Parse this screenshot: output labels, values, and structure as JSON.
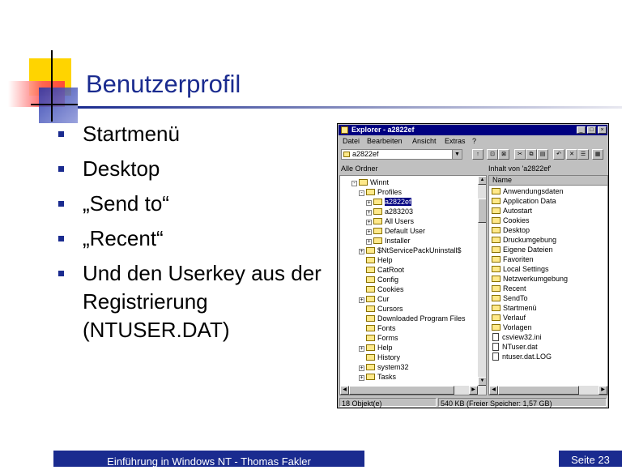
{
  "slide": {
    "title": "Benutzerprofil",
    "bullets": [
      "Startmenü",
      "Desktop",
      "„Send to“",
      "„Recent“",
      "Und den Userkey aus der Registrierung (NTUSER.DAT)"
    ],
    "footer_left": "Einführung in Windows NT - Thomas Fakler",
    "footer_right": "Seite 23",
    "colors": {
      "accent": "#1a2b8f",
      "deco_yellow": "#ffd400",
      "deco_red": "#ff3b3b",
      "deco_blue": "#2233aa"
    }
  },
  "explorer": {
    "title": "Explorer - a2822ef",
    "menu": [
      "Datei",
      "Bearbeiten",
      "Ansicht",
      "Extras",
      "?"
    ],
    "address_value": "a2822ef",
    "left_header": "Alle Ordner",
    "right_header": "Inhalt von 'a2822ef'",
    "right_column_header": "Name",
    "tree": [
      {
        "label": "Winnt",
        "indent": 2,
        "toggle": "-",
        "type": "folder"
      },
      {
        "label": "Profiles",
        "indent": 3,
        "toggle": "-",
        "type": "folder"
      },
      {
        "label": "a2822ef",
        "indent": 4,
        "toggle": "+",
        "type": "folder",
        "selected": true
      },
      {
        "label": "a283203",
        "indent": 4,
        "toggle": "+",
        "type": "folder"
      },
      {
        "label": "All Users",
        "indent": 4,
        "toggle": "+",
        "type": "folder"
      },
      {
        "label": "Default User",
        "indent": 4,
        "toggle": "+",
        "type": "folder"
      },
      {
        "label": "Installer",
        "indent": 4,
        "toggle": "+",
        "type": "folder"
      },
      {
        "label": "$NtServicePackUninstall$",
        "indent": 3,
        "toggle": "+",
        "type": "folder"
      },
      {
        "label": "Help",
        "indent": 3,
        "toggle": "",
        "type": "folder"
      },
      {
        "label": "CatRoot",
        "indent": 3,
        "toggle": "",
        "type": "folder"
      },
      {
        "label": "Config",
        "indent": 3,
        "toggle": "",
        "type": "folder"
      },
      {
        "label": "Cookies",
        "indent": 3,
        "toggle": "",
        "type": "folder"
      },
      {
        "label": "Cur",
        "indent": 3,
        "toggle": "+",
        "type": "folder"
      },
      {
        "label": "Cursors",
        "indent": 3,
        "toggle": "",
        "type": "folder"
      },
      {
        "label": "Downloaded Program Files",
        "indent": 3,
        "toggle": "",
        "type": "folder"
      },
      {
        "label": "Fonts",
        "indent": 3,
        "toggle": "",
        "type": "folder"
      },
      {
        "label": "Forms",
        "indent": 3,
        "toggle": "",
        "type": "folder"
      },
      {
        "label": "Help",
        "indent": 3,
        "toggle": "+",
        "type": "folder"
      },
      {
        "label": "History",
        "indent": 3,
        "toggle": "",
        "type": "folder"
      },
      {
        "label": "system32",
        "indent": 3,
        "toggle": "+",
        "type": "folder"
      },
      {
        "label": "Tasks",
        "indent": 3,
        "toggle": "+",
        "type": "folder"
      }
    ],
    "files": [
      {
        "label": "Anwendungsdaten",
        "type": "folder"
      },
      {
        "label": "Application Data",
        "type": "folder"
      },
      {
        "label": "Autostart",
        "type": "folder"
      },
      {
        "label": "Cookies",
        "type": "folder"
      },
      {
        "label": "Desktop",
        "type": "folder"
      },
      {
        "label": "Druckumgebung",
        "type": "folder"
      },
      {
        "label": "Eigene Dateien",
        "type": "folder"
      },
      {
        "label": "Favoriten",
        "type": "folder"
      },
      {
        "label": "Local Settings",
        "type": "folder"
      },
      {
        "label": "Netzwerkumgebung",
        "type": "folder"
      },
      {
        "label": "Recent",
        "type": "folder"
      },
      {
        "label": "SendTo",
        "type": "folder"
      },
      {
        "label": "Startmenü",
        "type": "folder"
      },
      {
        "label": "Verlauf",
        "type": "folder"
      },
      {
        "label": "Vorlagen",
        "type": "folder"
      },
      {
        "label": "csview32.ini",
        "type": "file"
      },
      {
        "label": "NTuser.dat",
        "type": "file"
      },
      {
        "label": "ntuser.dat.LOG",
        "type": "file"
      }
    ],
    "status_left": "18 Objekt(e)",
    "status_right": "540 KB (Freier Speicher: 1,57 GB)"
  }
}
